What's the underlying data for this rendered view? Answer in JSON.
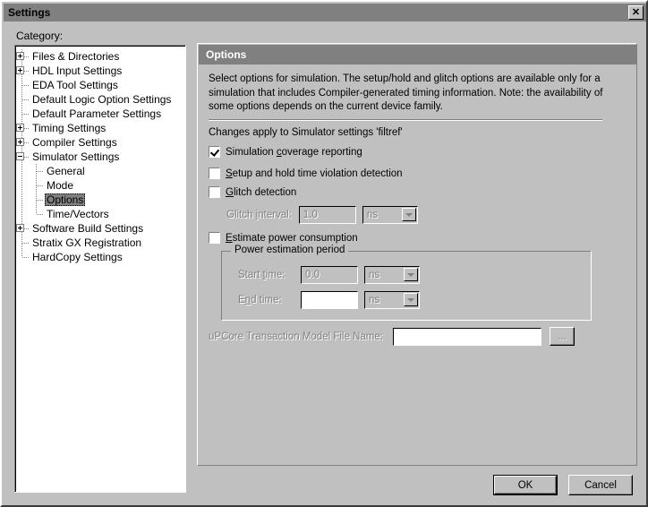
{
  "window": {
    "title": "Settings",
    "close_icon": "close-icon"
  },
  "category": {
    "label": "Category:",
    "items": [
      {
        "label": "Files & Directories",
        "level": 0,
        "toggle": "plus"
      },
      {
        "label": "HDL Input Settings",
        "level": 0,
        "toggle": "plus"
      },
      {
        "label": "EDA Tool Settings",
        "level": 0,
        "toggle": "none"
      },
      {
        "label": "Default Logic Option Settings",
        "level": 0,
        "toggle": "none"
      },
      {
        "label": "Default Parameter Settings",
        "level": 0,
        "toggle": "none"
      },
      {
        "label": "Timing Settings",
        "level": 0,
        "toggle": "plus"
      },
      {
        "label": "Compiler Settings",
        "level": 0,
        "toggle": "plus"
      },
      {
        "label": "Simulator Settings",
        "level": 0,
        "toggle": "minus"
      },
      {
        "label": "General",
        "level": 1,
        "toggle": "none"
      },
      {
        "label": "Mode",
        "level": 1,
        "toggle": "none"
      },
      {
        "label": "Options",
        "level": 1,
        "toggle": "none",
        "selected": true
      },
      {
        "label": "Time/Vectors",
        "level": 1,
        "toggle": "none"
      },
      {
        "label": "Software Build Settings",
        "level": 0,
        "toggle": "plus"
      },
      {
        "label": "Stratix GX Registration",
        "level": 0,
        "toggle": "none"
      },
      {
        "label": "HardCopy Settings",
        "level": 0,
        "toggle": "none"
      }
    ]
  },
  "options": {
    "header": "Options",
    "description": "Select options for simulation.  The setup/hold and glitch options are available only for a simulation that includes Compiler-generated timing information.  Note: the availability of some options depends on the current device family.",
    "changes_line": "Changes apply to Simulator settings 'filtref'",
    "coverage": {
      "label_pre": "Simulation ",
      "label_accel": "c",
      "label_post": "overage reporting",
      "checked": true
    },
    "setup_hold": {
      "label_pre": "",
      "label_accel": "S",
      "label_post": "etup and hold time violation detection",
      "checked": false
    },
    "glitch": {
      "label_pre": "",
      "label_accel": "G",
      "label_post": "litch detection",
      "checked": false
    },
    "glitch_interval": {
      "label_pre": "Glitch ",
      "label_accel": "i",
      "label_post": "nterval:",
      "value": "1.0",
      "unit": "ns"
    },
    "estimate_power": {
      "label_pre": "",
      "label_accel": "E",
      "label_post": "stimate power consumption",
      "checked": false
    },
    "power_group": {
      "title": "Power estimation period",
      "start": {
        "label_pre": "Start ",
        "label_accel": "t",
        "label_post": "ime:",
        "value": "0.0",
        "unit": "ns"
      },
      "end": {
        "label_pre": "E",
        "label_accel": "n",
        "label_post": "d time:",
        "value": "",
        "unit": "ns"
      }
    },
    "upcore": {
      "label": "uPCore Transaction Model File Name:",
      "value": "",
      "browse_label": "..."
    }
  },
  "footer": {
    "ok": "OK",
    "cancel": "Cancel"
  }
}
